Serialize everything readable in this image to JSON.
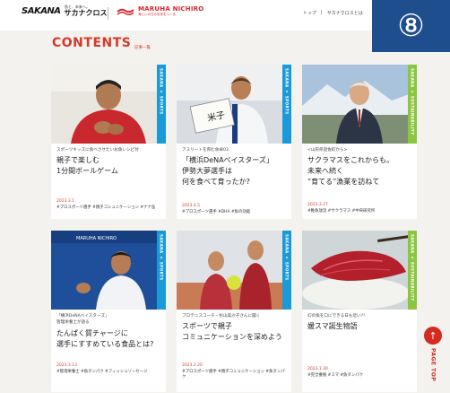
{
  "header": {
    "brand_mark": "SAKANA",
    "brand_tagline": "魚と、未来へ。",
    "brand_name": "サカナクロス",
    "partner_name": "MARUHA NICHIRO",
    "partner_tagline": "海といのちの未来をつくる",
    "nav": [
      "トップ",
      "|",
      "サカナクロスとは"
    ],
    "badge_number": "⑧"
  },
  "section": {
    "title": "CONTENTS",
    "subtitle": "記事一覧"
  },
  "cards": [
    {
      "strip": "SAKANA × SPORTS",
      "lead": "スポーツキッズに食べさせたいお魚レシピ付",
      "title": "親子で楽しむ\n1分間ボールゲーム",
      "date": "2023.3.1",
      "tags": "#プロスポーツ選手 #親子コミュニケーション #ナナ缶"
    },
    {
      "strip": "SAKANA × SPORTS",
      "lead": "アスリートを育む食卓03",
      "title": "「横浜DeNAベイスターズ」\n伊勢大夢選手は\n何を食べて育ったか?",
      "date": "2023.4.5",
      "tags": "#プロスポーツ選手 #DHA #魚の効能",
      "sign": "米子"
    },
    {
      "strip": "SAKANA × SUSTAINABILITY",
      "lead": "<山形県遊佐町から>",
      "title": "サクラマスをこれからも。\n未来へ続く\n“育てる”漁業を訪ねて",
      "date": "2023.3.27",
      "tags": "#稚魚放流 #サクラマス #中央研究所"
    },
    {
      "strip": "SAKANA × SPORTS",
      "lead": "「横浜DeNAベイスターズ」\n管理栄養士が語る",
      "title": "たんぱく質チャージに\n選手にすすめている食品とは?",
      "date": "2023.3.13",
      "tags": "#管理栄養士 #魚タンパク #フィッシュソーセージ",
      "logo": "MARUHA NICHIRO"
    },
    {
      "strip": "SAKANA × SPORTS",
      "lead": "プロテニスコーチ・杉山美沙子さんに聞く",
      "title": "スポーツで親子\nコミュニケーションを深めよう",
      "date": "2023.2.20",
      "tags": "#プロスポーツ選手 #親子コミュニケーション #魚タンパク"
    },
    {
      "strip": "SAKANA × SUSTAINABILITY",
      "lead": "幻の魚を口にできる日も近い?!",
      "title": "媛スマ誕生物語",
      "date": "2023.1.30",
      "tags": "#完全養殖 #スマ #魚タンパク"
    }
  ],
  "pagetop": {
    "arrow": "↑",
    "label": "PAGE TOP"
  },
  "colors": {
    "accent": "#d43a2a",
    "badge": "#1f4e8f",
    "sports": "#1a9ad6",
    "sustainability": "#8cc63f"
  }
}
